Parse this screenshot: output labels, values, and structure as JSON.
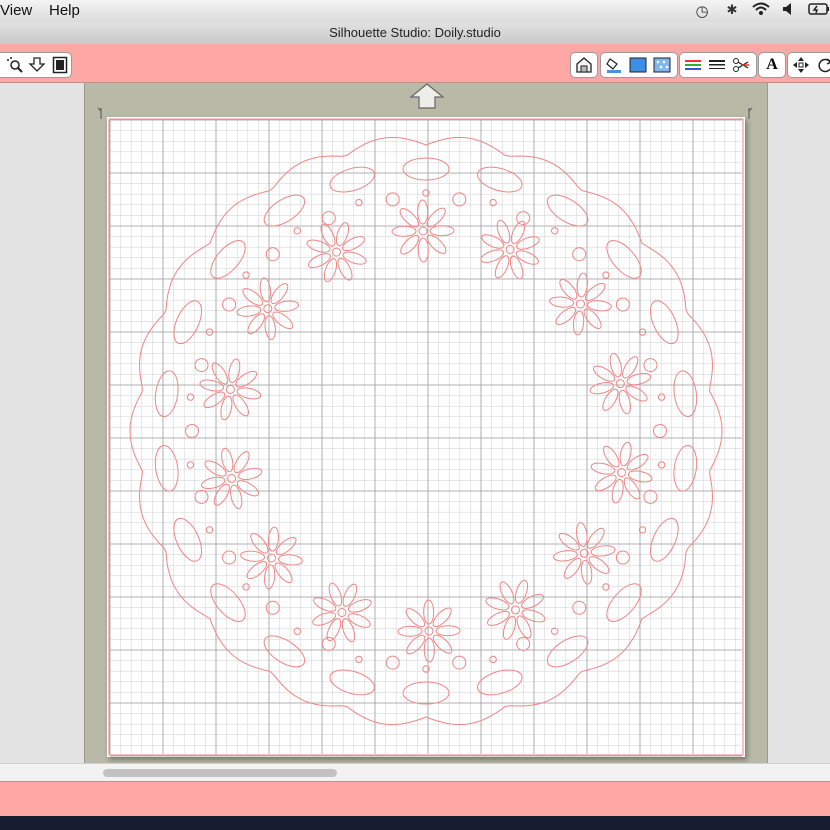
{
  "menubar": {
    "items": [
      "View",
      "Help"
    ],
    "status_icons": [
      "time-machine-icon",
      "bluetooth-icon",
      "wifi-icon",
      "volume-icon",
      "battery-icon"
    ]
  },
  "window": {
    "title": "Silhouette Studio: Doily.studio"
  },
  "toolbar": {
    "left_tools": [
      "zoom-select-icon",
      "import-icon",
      "page-view-icon"
    ],
    "right_tools": [
      "library-icon",
      "fill-icon",
      "fill-color-icon",
      "fill-pattern-icon",
      "line-color-icon",
      "line-style-icon",
      "cut-style-icon",
      "text-style-icon",
      "transform-icon",
      "replicate-icon"
    ],
    "text_tool_glyph": "A"
  },
  "canvas": {
    "grid_color": "#cfcfcf",
    "cut_line_color": "#f08585",
    "mat_color": "#b9b9a7",
    "accent_color": "#fda8a4"
  }
}
